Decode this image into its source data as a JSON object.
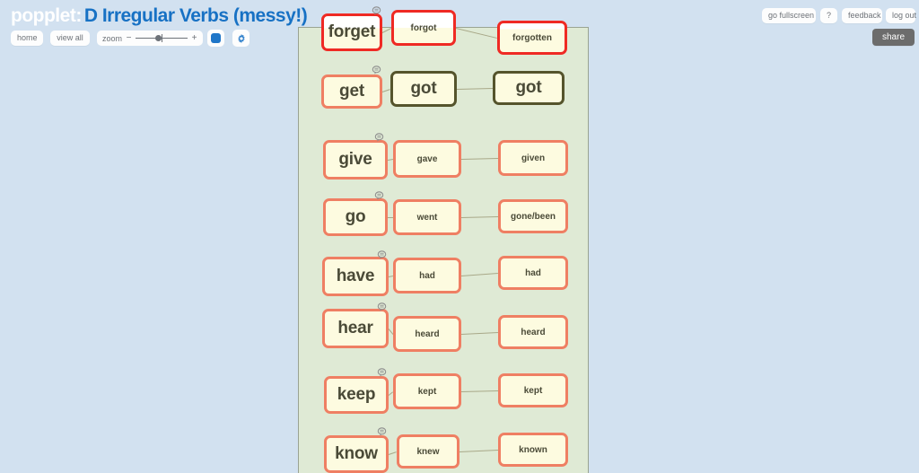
{
  "header": {
    "logo": "popplet:",
    "title": "D Irregular Verbs (messy!)",
    "buttons": {
      "home": "home",
      "view_all": "view all",
      "go_fullscreen": "go fullscreen",
      "help": "?",
      "feedback": "feedback",
      "log_out": "log out",
      "share": "share"
    },
    "zoom": {
      "label": "zoom",
      "minus": "−",
      "plus": "+",
      "value_percent": 38
    },
    "color_swatch": "#1f76c8",
    "gear_icon": "gear-icon"
  },
  "canvas": {
    "background_color": "#dfead5",
    "border_color": "#9aa392",
    "connector_color": "#a8a888",
    "popple_fill": "#fdfbe0",
    "popple_border": "#ef7f63",
    "popple_border_selected": "#ef2a24",
    "popple_border_dark": "#55542c",
    "rows": [
      {
        "base": "forget",
        "past": "forgot",
        "participle": "forgotten",
        "state": "selected"
      },
      {
        "base": "get",
        "past": "got",
        "participle": "got",
        "state": "dark"
      },
      {
        "base": "give",
        "past": "gave",
        "participle": "given",
        "state": "normal"
      },
      {
        "base": "go",
        "past": "went",
        "participle": "gone/been",
        "state": "normal"
      },
      {
        "base": "have",
        "past": "had",
        "participle": "had",
        "state": "normal"
      },
      {
        "base": "hear",
        "past": "heard",
        "participle": "heard",
        "state": "normal"
      },
      {
        "base": "keep",
        "past": "kept",
        "participle": "kept",
        "state": "normal"
      },
      {
        "base": "know",
        "past": "knew",
        "participle": "known",
        "state": "normal"
      }
    ]
  }
}
